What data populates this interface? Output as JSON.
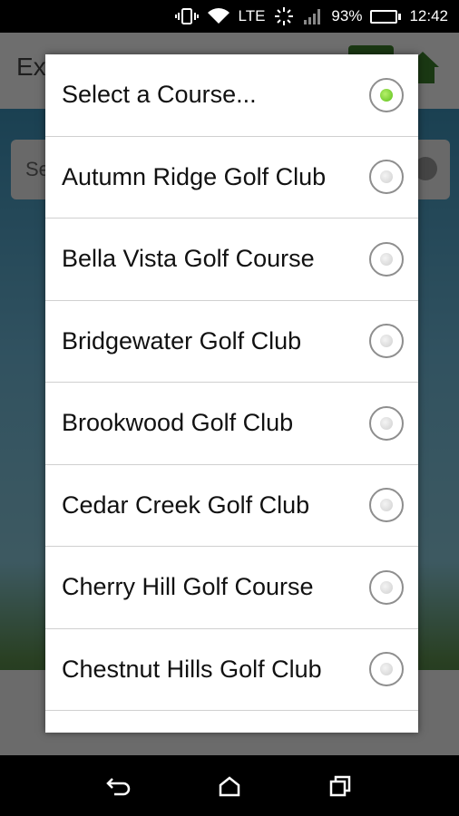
{
  "status_bar": {
    "network": "LTE",
    "battery_percent": "93%",
    "battery_level": 0.93,
    "time": "12:42"
  },
  "background_app": {
    "title_fragment": "Ex",
    "select_fragment": "Se"
  },
  "dialog": {
    "selected_index": 0,
    "options": [
      {
        "label": "Select a Course...",
        "selected": true
      },
      {
        "label": "Autumn Ridge Golf Club",
        "selected": false
      },
      {
        "label": "Bella Vista Golf Course",
        "selected": false
      },
      {
        "label": "Bridgewater Golf Club",
        "selected": false
      },
      {
        "label": "Brookwood Golf Club",
        "selected": false
      },
      {
        "label": "Cedar Creek Golf Club",
        "selected": false
      },
      {
        "label": "Cherry Hill Golf Course",
        "selected": false
      },
      {
        "label": "Chestnut Hills Golf Club",
        "selected": false
      }
    ]
  },
  "navbar": {
    "icons": [
      "back-icon",
      "home-icon",
      "recents-icon"
    ]
  },
  "colors": {
    "accent_green": "#5bbf1a",
    "dialog_bg": "#ffffff",
    "divider": "#d0d0d0"
  }
}
